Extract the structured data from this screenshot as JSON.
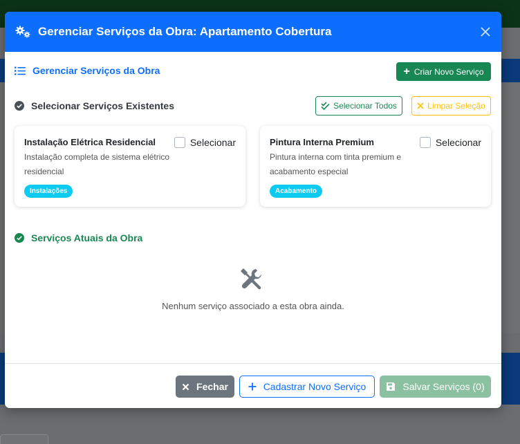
{
  "modal": {
    "title": "Gerenciar Serviços da Obra: Apartamento Cobertura",
    "section_title": "Gerenciar Serviços da Obra",
    "create_button": "Criar Novo Serviço",
    "select_section": "Selecionar Serviços Existentes",
    "select_all_button": "Selecionar Todos",
    "clear_button": "Limpar Seleção",
    "services": [
      {
        "title": "Instalação Elétrica Residencial",
        "description": "Instalação completa de sistema elétrico residencial",
        "category": "Instalações",
        "select_label": "Selecionar",
        "checked": false
      },
      {
        "title": "Pintura Interna Premium",
        "description": "Pintura interna com tinta premium e acabamento especial",
        "category": "Acabamento",
        "select_label": "Selecionar",
        "checked": false
      }
    ],
    "current_section": "Serviços Atuais da Obra",
    "empty_message": "Nenhum serviço associado a esta obra ainda.",
    "footer": {
      "close_button": "Fechar",
      "register_button": "Cadastrar Novo Serviço",
      "save_button": "Salvar Serviços (0)"
    }
  },
  "colors": {
    "primary": "#0d6efd",
    "success": "#198754",
    "warning": "#ffc107",
    "info": "#0dcaf0",
    "secondary": "#6c757d"
  },
  "icons": [
    "cogs-icon",
    "close-icon",
    "list-icon",
    "plus-icon",
    "check-circle-icon",
    "check-double-icon",
    "times-icon",
    "tools-icon",
    "save-icon"
  ]
}
